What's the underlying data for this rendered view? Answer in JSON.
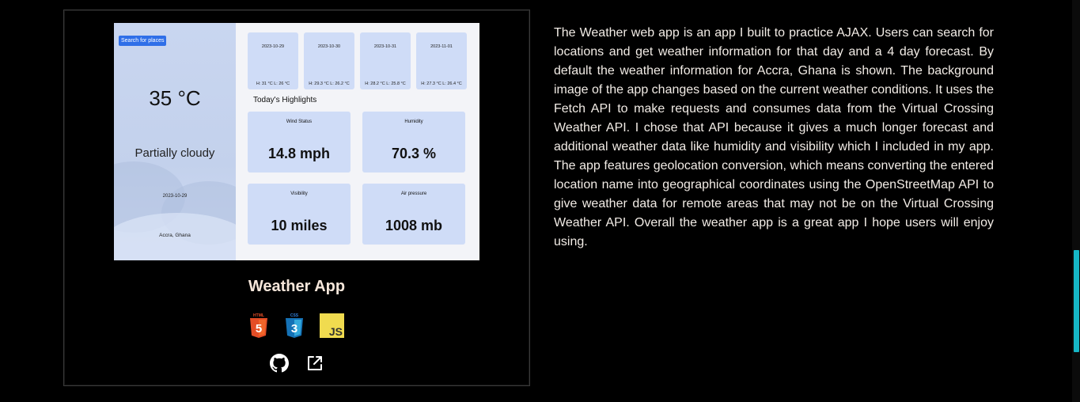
{
  "project": {
    "title": "Weather App",
    "description": "The Weather web app is an app I built to practice AJAX. Users can search for locations and get weather information for that day and a 4 day forecast. By default the weather information for Accra, Ghana is shown. The background image of the app changes based on the current weather conditions. It uses the Fetch API to make requests and consumes data from the Virtual Crossing Weather API. I chose that API because it gives a much longer forecast and additional weather data like humidity and visibility which I included in my app. The app features geolocation conversion, which means converting the entered location name into geographical coordinates using the OpenStreetMap API to give weather data for remote areas that may not be on the Virtual Crossing Weather API. Overall the weather app is a great app I hope users will enjoy using.",
    "tech_icons": [
      {
        "name": "html5-icon",
        "label": "HTML",
        "color": "#e44d26"
      },
      {
        "name": "css3-icon",
        "label": "CSS",
        "color": "#2f7ed8"
      },
      {
        "name": "javascript-icon",
        "label": "JS",
        "color": "#f0db4f"
      }
    ],
    "link_icons": [
      "github-icon",
      "external-link-icon"
    ]
  },
  "preview": {
    "search_label": "Search for places",
    "temperature": "35 °C",
    "condition": "Partially cloudy",
    "date": "2023-10-29",
    "location": "Accra, Ghana",
    "forecast": [
      {
        "date": "2023-10-29",
        "hilo": "H: 31 °C    L: 26 °C"
      },
      {
        "date": "2023-10-30",
        "hilo": "H: 29.3 °C    L: 26.2 °C"
      },
      {
        "date": "2023-10-31",
        "hilo": "H: 28.2 °C    L: 25.8 °C"
      },
      {
        "date": "2023-11-01",
        "hilo": "H: 27.3 °C    L: 26.4 °C"
      }
    ],
    "highlights_title": "Today's Highlights",
    "highlights": [
      {
        "label": "Wind Status",
        "value": "14.8 mph"
      },
      {
        "label": "Humidity",
        "value": "70.3 %"
      },
      {
        "label": "Visibility",
        "value": "10 miles"
      },
      {
        "label": "Air pressure",
        "value": "1008 mb"
      }
    ]
  },
  "colors": {
    "accent": "#16b6c6",
    "title": "#f5e6da",
    "card_bg": "#cfdcf7",
    "search_btn": "#2f6fe8"
  }
}
